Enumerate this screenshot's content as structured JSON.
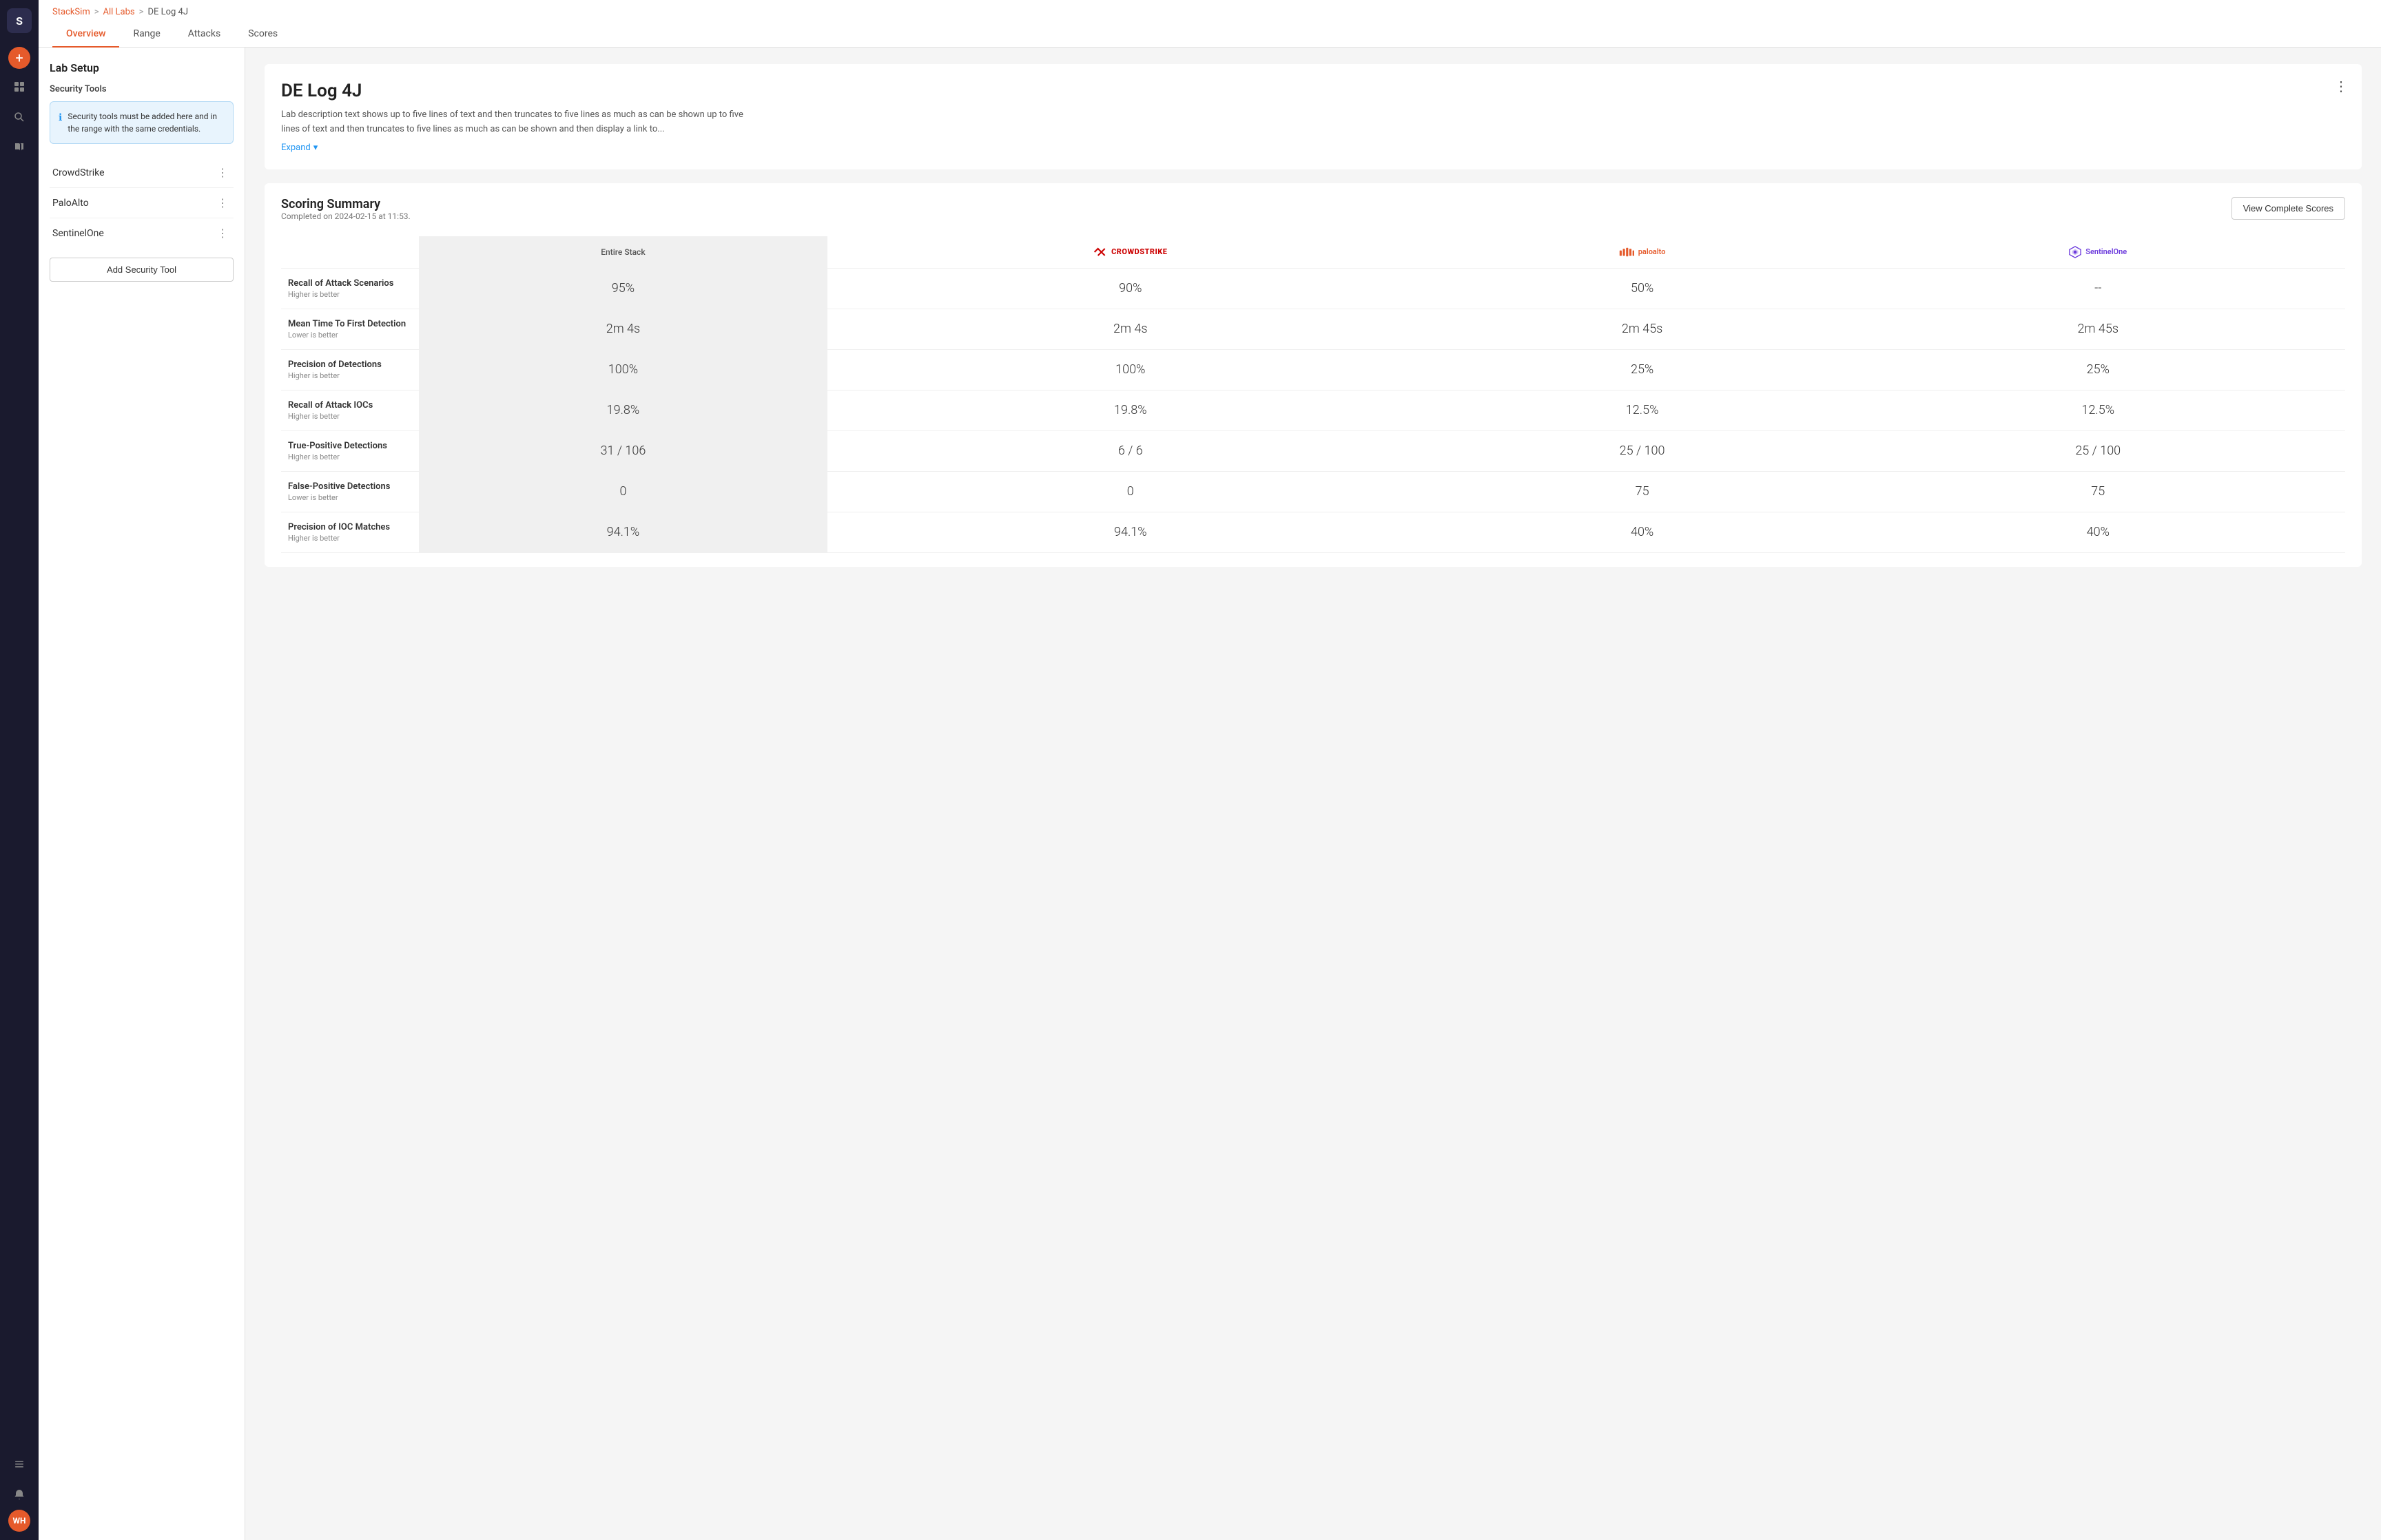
{
  "sidebar": {
    "logo_text": "S",
    "avatar_text": "WH",
    "icons": [
      {
        "name": "grid-icon",
        "symbol": "⊞",
        "active": false
      },
      {
        "name": "plus-icon",
        "symbol": "+",
        "active": false
      },
      {
        "name": "search-icon",
        "symbol": "🔍",
        "active": false
      },
      {
        "name": "book-icon",
        "symbol": "📖",
        "active": false
      },
      {
        "name": "list-icon",
        "symbol": "☰",
        "active": false
      },
      {
        "name": "bell-icon",
        "symbol": "🔔",
        "active": false
      }
    ]
  },
  "breadcrumb": {
    "stacksim": "StackSim",
    "all_labs": "All Labs",
    "current": "DE Log 4J",
    "sep1": ">",
    "sep2": ">"
  },
  "tabs": [
    {
      "label": "Overview",
      "active": true
    },
    {
      "label": "Range",
      "active": false
    },
    {
      "label": "Attacks",
      "active": false
    },
    {
      "label": "Scores",
      "active": false
    }
  ],
  "left_panel": {
    "title": "Lab Setup",
    "security_tools_label": "Security Tools",
    "info_message": "Security tools must be added here and in the range with the same credentials.",
    "tools": [
      {
        "name": "CrowdStrike"
      },
      {
        "name": "PaloAlto"
      },
      {
        "name": "SentinelOne"
      }
    ],
    "add_button_label": "Add Security Tool"
  },
  "lab": {
    "title": "DE Log 4J",
    "description": "Lab description text shows up to five lines of text and then truncates to five lines as much as can be shown up to five lines of text and then truncates to five lines as much as can be shown and then display a link to...",
    "expand_label": "Expand",
    "expand_icon": "▾"
  },
  "scoring": {
    "title": "Scoring Summary",
    "subtitle": "Completed on 2024-02-15 at 11:53.",
    "view_button_label": "View Complete Scores",
    "columns": {
      "entire_stack": "Entire Stack",
      "crowdstrike": "CROWDSTRIKE",
      "paloalto": "paloalto",
      "sentinelone": "SentinelOne"
    },
    "rows": [
      {
        "metric": "Recall of Attack Scenarios",
        "hint": "Higher is better",
        "entire_stack": "95%",
        "crowdstrike": "90%",
        "paloalto": "50%",
        "sentinelone": "--"
      },
      {
        "metric": "Mean Time To First Detection",
        "hint": "Lower is better",
        "entire_stack": "2m 4s",
        "crowdstrike": "2m 4s",
        "paloalto": "2m 45s",
        "sentinelone": "2m 45s"
      },
      {
        "metric": "Precision of Detections",
        "hint": "Higher is better",
        "entire_stack": "100%",
        "crowdstrike": "100%",
        "paloalto": "25%",
        "sentinelone": "25%"
      },
      {
        "metric": "Recall of Attack IOCs",
        "hint": "Higher is better",
        "entire_stack": "19.8%",
        "crowdstrike": "19.8%",
        "paloalto": "12.5%",
        "sentinelone": "12.5%"
      },
      {
        "metric": "True-Positive Detections",
        "hint": "Higher is better",
        "entire_stack": "31 / 106",
        "crowdstrike": "6 / 6",
        "paloalto": "25 / 100",
        "sentinelone": "25 / 100"
      },
      {
        "metric": "False-Positive Detections",
        "hint": "Lower is better",
        "entire_stack": "0",
        "crowdstrike": "0",
        "paloalto": "75",
        "sentinelone": "75"
      },
      {
        "metric": "Precision of IOC Matches",
        "hint": "Higher is better",
        "entire_stack": "94.1%",
        "crowdstrike": "94.1%",
        "paloalto": "40%",
        "sentinelone": "40%"
      }
    ]
  }
}
